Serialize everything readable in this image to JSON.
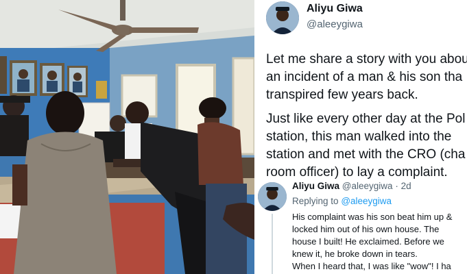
{
  "tweet": {
    "author_name": "Aliyu Giwa",
    "author_handle": "@aleeygiwa",
    "paragraph1_lines": [
      "Let me share a story with you abou",
      "an incident of a man & his son tha",
      "transpired few years back."
    ],
    "paragraph2_lines": [
      "Just like every other day at the Pol",
      "station, this man walked into the",
      "station and met with the CRO (cha",
      "room officer) to lay a complaint."
    ]
  },
  "reply": {
    "author_name": "Aliyu Giwa",
    "author_handle": "@aleeygiwa",
    "separator": "·",
    "time": "2d",
    "replying_prefix": "Replying to",
    "replying_handle": "@aleeygiwa",
    "body_lines": [
      "His complaint was his son beat him up &",
      "locked him out of his own house. The",
      "house I built! He exclaimed. Before we",
      "knew it, he broke down in tears.",
      "When I heard that, I was like \"wow\"! I ha"
    ]
  },
  "colors": {
    "link_blue": "#1d9bf0",
    "wall_blue": "#3f78b0",
    "counter_red": "#b24a3c"
  }
}
